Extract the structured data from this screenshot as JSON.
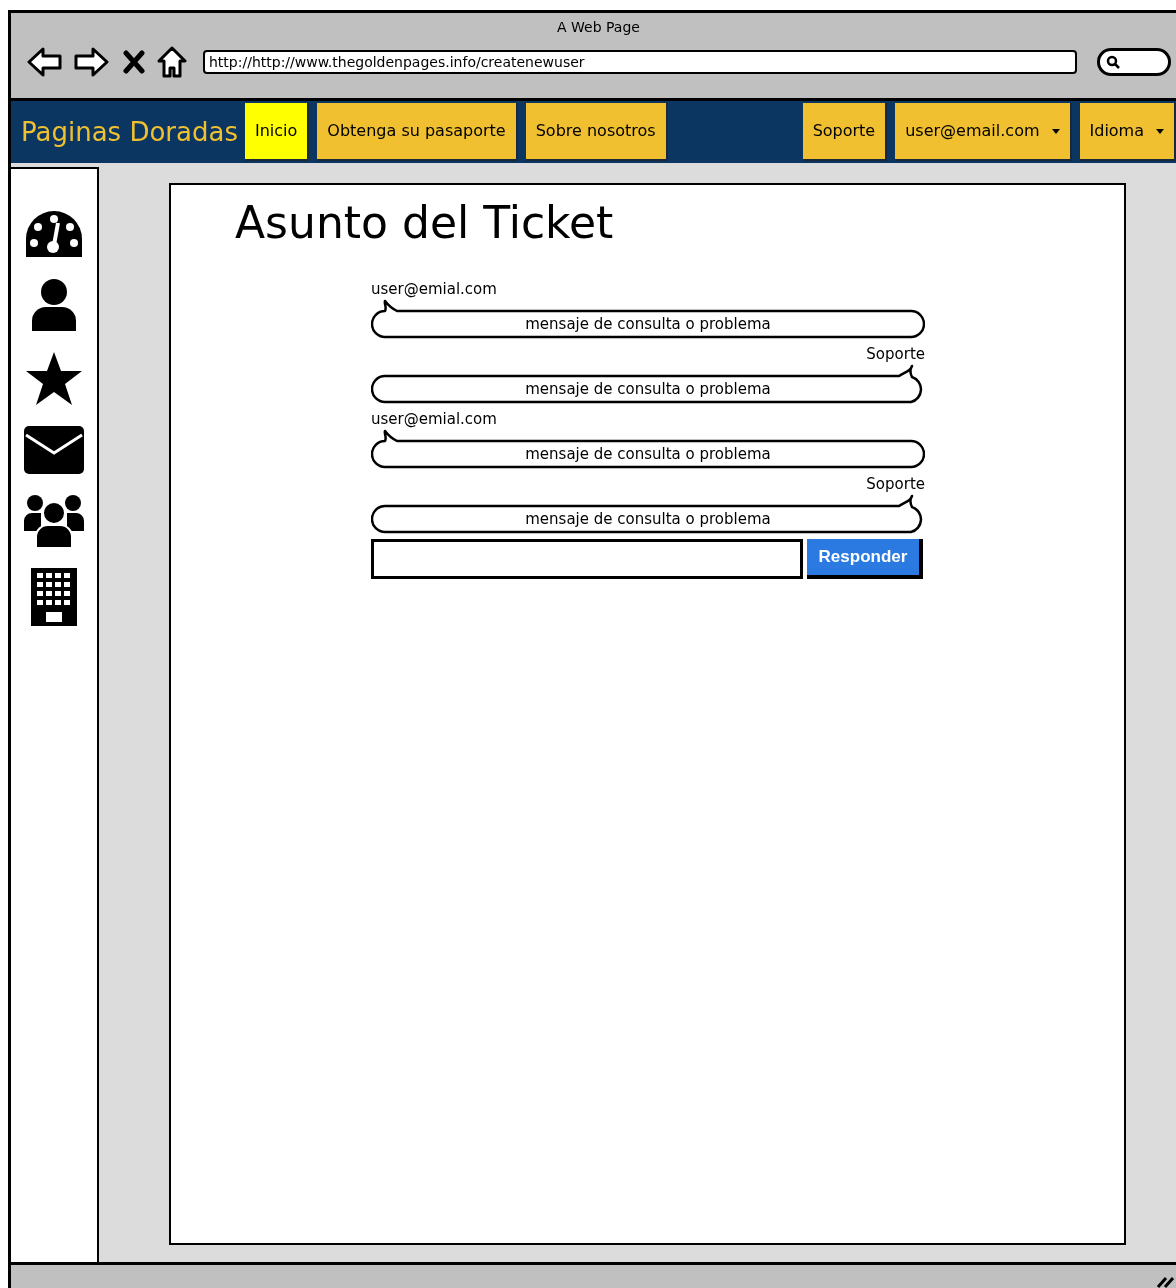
{
  "window": {
    "title": "A Web Page"
  },
  "address_bar": {
    "url": "http://http://www.thegoldenpages.info/createnewuser"
  },
  "nav": {
    "brand": "Paginas Doradas",
    "left_items": [
      {
        "label": "Inicio",
        "selected": true,
        "kind": "link"
      },
      {
        "label": "Obtenga su pasaporte",
        "selected": false,
        "kind": "link"
      },
      {
        "label": "Sobre nosotros",
        "selected": false,
        "kind": "link"
      }
    ],
    "right_items": [
      {
        "label": "Soporte",
        "selected": false,
        "kind": "link"
      },
      {
        "label": "user@email.com",
        "selected": false,
        "kind": "dropdown"
      },
      {
        "label": "Idioma",
        "selected": false,
        "kind": "dropdown"
      }
    ]
  },
  "ticket": {
    "title": "Asunto del Ticket",
    "messages": [
      {
        "author": "user@emial.com",
        "text": "mensaje de consulta o problema",
        "kind": "incoming"
      },
      {
        "author": "Soporte",
        "text": "mensaje de consulta o problema",
        "kind": "outgoing"
      },
      {
        "author": "user@emial.com",
        "text": "mensaje de consulta o problema",
        "kind": "incoming"
      },
      {
        "author": "Soporte",
        "text": "mensaje de consulta o problema",
        "kind": "outgoing"
      }
    ],
    "reply": {
      "button": "Responder"
    }
  }
}
